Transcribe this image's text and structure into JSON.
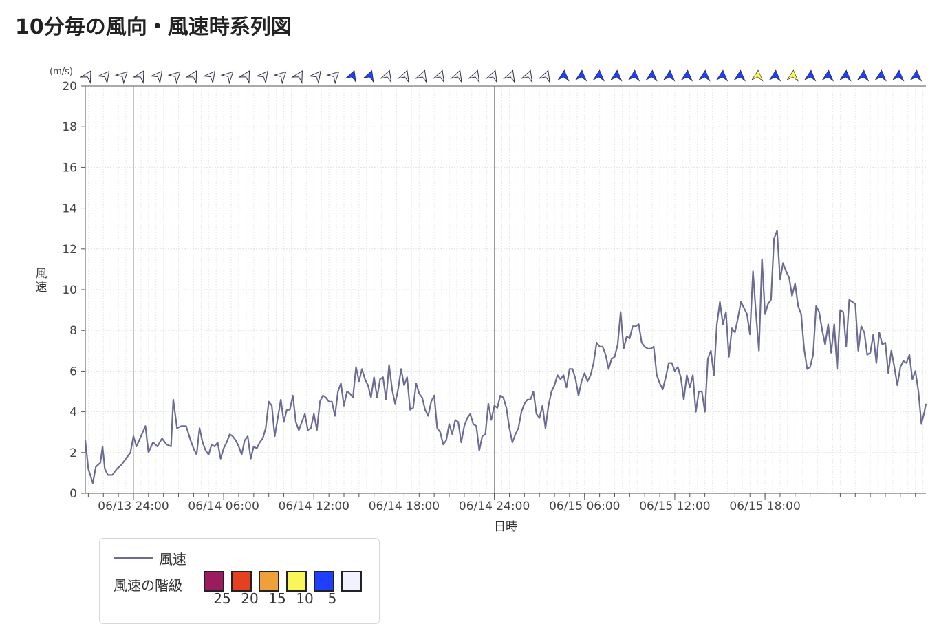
{
  "title": "10分毎の風向・風速時系列図",
  "legend": {
    "series_label": "風速",
    "classes_label": "風速の階級",
    "classes": [
      {
        "color": "#9b1c5e",
        "label": "25"
      },
      {
        "color": "#e5401f",
        "label": "20"
      },
      {
        "color": "#f0a03a",
        "label": "15"
      },
      {
        "color": "#f9f65a",
        "label": "10"
      },
      {
        "color": "#1e3ffb",
        "label": "5"
      },
      {
        "color": "#f1f2fd",
        "label": ""
      }
    ]
  },
  "chart_data": {
    "type": "line",
    "ylabel": "風速",
    "xlabel": "日時",
    "yunit": "(m/s)",
    "ylim": [
      0,
      20
    ],
    "yticks": [
      0,
      2,
      4,
      6,
      8,
      10,
      12,
      14,
      16,
      18,
      20
    ],
    "xlim_hours": [
      20.8,
      68.7
    ],
    "xticks": [
      {
        "hour": 24,
        "label": "06/13 24:00"
      },
      {
        "hour": 30,
        "label": "06/14 06:00"
      },
      {
        "hour": 36,
        "label": "06/14 12:00"
      },
      {
        "hour": 42,
        "label": "06/14 18:00"
      },
      {
        "hour": 48,
        "label": "06/14 24:00"
      },
      {
        "hour": 54,
        "label": "06/15 06:00"
      },
      {
        "hour": 60,
        "label": "06/15 12:00"
      },
      {
        "hour": 66,
        "label": "06/15 18:00"
      }
    ],
    "grid": true,
    "series": [
      {
        "name": "風速",
        "color": "#6b6b96",
        "points": [
          [
            20.8,
            2.6
          ],
          [
            21.0,
            1.2
          ],
          [
            21.3,
            0.5
          ],
          [
            21.5,
            1.3
          ],
          [
            21.8,
            1.5
          ],
          [
            21.95,
            2.3
          ],
          [
            22.1,
            1.2
          ],
          [
            22.3,
            0.9
          ],
          [
            22.6,
            0.9
          ],
          [
            22.9,
            1.2
          ],
          [
            23.2,
            1.4
          ],
          [
            23.5,
            1.7
          ],
          [
            23.8,
            2.0
          ],
          [
            24.0,
            2.8
          ],
          [
            24.2,
            2.3
          ],
          [
            24.5,
            2.8
          ],
          [
            24.8,
            3.3
          ],
          [
            25.0,
            2.0
          ],
          [
            25.3,
            2.5
          ],
          [
            25.6,
            2.3
          ],
          [
            25.9,
            2.7
          ],
          [
            26.2,
            2.4
          ],
          [
            26.5,
            2.3
          ],
          [
            26.65,
            4.6
          ],
          [
            26.9,
            3.2
          ],
          [
            27.2,
            3.3
          ],
          [
            27.5,
            3.3
          ],
          [
            27.8,
            2.6
          ],
          [
            28.0,
            2.2
          ],
          [
            28.2,
            1.9
          ],
          [
            28.4,
            3.2
          ],
          [
            28.6,
            2.5
          ],
          [
            28.8,
            2.1
          ],
          [
            29.0,
            1.9
          ],
          [
            29.2,
            2.4
          ],
          [
            29.4,
            2.3
          ],
          [
            29.6,
            2.5
          ],
          [
            29.8,
            1.7
          ],
          [
            30.0,
            2.2
          ],
          [
            30.2,
            2.5
          ],
          [
            30.4,
            2.9
          ],
          [
            30.6,
            2.8
          ],
          [
            30.8,
            2.6
          ],
          [
            31.0,
            2.3
          ],
          [
            31.2,
            1.9
          ],
          [
            31.4,
            2.6
          ],
          [
            31.6,
            2.8
          ],
          [
            31.8,
            1.7
          ],
          [
            32.0,
            2.3
          ],
          [
            32.2,
            2.2
          ],
          [
            32.4,
            2.5
          ],
          [
            32.6,
            2.7
          ],
          [
            32.8,
            3.2
          ],
          [
            33.0,
            4.5
          ],
          [
            33.2,
            4.3
          ],
          [
            33.4,
            2.8
          ],
          [
            33.6,
            3.7
          ],
          [
            33.8,
            4.6
          ],
          [
            34.0,
            3.5
          ],
          [
            34.2,
            4.1
          ],
          [
            34.4,
            4.1
          ],
          [
            34.6,
            4.8
          ],
          [
            34.8,
            3.5
          ],
          [
            35.0,
            3.1
          ],
          [
            35.2,
            3.5
          ],
          [
            35.4,
            3.9
          ],
          [
            35.6,
            3.1
          ],
          [
            35.8,
            3.2
          ],
          [
            36.0,
            3.9
          ],
          [
            36.2,
            3.1
          ],
          [
            36.4,
            4.5
          ],
          [
            36.6,
            4.8
          ],
          [
            36.8,
            4.7
          ],
          [
            37.0,
            4.5
          ],
          [
            37.2,
            4.5
          ],
          [
            37.4,
            3.8
          ],
          [
            37.6,
            5.0
          ],
          [
            37.8,
            5.4
          ],
          [
            38.0,
            4.3
          ],
          [
            38.2,
            5.0
          ],
          [
            38.4,
            4.9
          ],
          [
            38.6,
            4.7
          ],
          [
            38.8,
            6.2
          ],
          [
            39.0,
            5.5
          ],
          [
            39.2,
            6.1
          ],
          [
            39.4,
            5.6
          ],
          [
            39.6,
            5.3
          ],
          [
            39.8,
            4.7
          ],
          [
            40.0,
            5.7
          ],
          [
            40.2,
            4.7
          ],
          [
            40.4,
            5.6
          ],
          [
            40.6,
            5.7
          ],
          [
            40.8,
            4.6
          ],
          [
            41.0,
            6.3
          ],
          [
            41.2,
            5.1
          ],
          [
            41.4,
            4.4
          ],
          [
            41.6,
            5.1
          ],
          [
            41.8,
            6.1
          ],
          [
            42.0,
            5.3
          ],
          [
            42.2,
            5.7
          ],
          [
            42.4,
            4.1
          ],
          [
            42.6,
            4.2
          ],
          [
            42.8,
            5.4
          ],
          [
            43.0,
            4.9
          ],
          [
            43.2,
            4.7
          ],
          [
            43.4,
            4.1
          ],
          [
            43.6,
            3.8
          ],
          [
            43.8,
            4.5
          ],
          [
            44.0,
            4.8
          ],
          [
            44.2,
            3.2
          ],
          [
            44.4,
            3.0
          ],
          [
            44.6,
            2.4
          ],
          [
            44.8,
            2.6
          ],
          [
            45.0,
            3.4
          ],
          [
            45.2,
            2.9
          ],
          [
            45.4,
            3.6
          ],
          [
            45.6,
            3.5
          ],
          [
            45.8,
            2.5
          ],
          [
            46.0,
            3.3
          ],
          [
            46.2,
            3.7
          ],
          [
            46.4,
            3.9
          ],
          [
            46.6,
            3.4
          ],
          [
            46.8,
            3.3
          ],
          [
            47.0,
            2.1
          ],
          [
            47.2,
            2.8
          ],
          [
            47.4,
            2.9
          ],
          [
            47.6,
            4.4
          ],
          [
            47.8,
            3.6
          ],
          [
            48.0,
            4.3
          ],
          [
            48.2,
            4.2
          ],
          [
            48.4,
            4.8
          ],
          [
            48.6,
            4.7
          ],
          [
            48.8,
            4.2
          ],
          [
            49.0,
            3.2
          ],
          [
            49.2,
            2.5
          ],
          [
            49.4,
            2.9
          ],
          [
            49.6,
            3.2
          ],
          [
            49.8,
            4.0
          ],
          [
            50.0,
            4.4
          ],
          [
            50.2,
            4.6
          ],
          [
            50.4,
            4.6
          ],
          [
            50.6,
            5.0
          ],
          [
            50.8,
            3.9
          ],
          [
            51.0,
            3.7
          ],
          [
            51.2,
            4.3
          ],
          [
            51.4,
            3.2
          ],
          [
            51.6,
            4.3
          ],
          [
            51.8,
            5.0
          ],
          [
            52.0,
            5.3
          ],
          [
            52.2,
            5.8
          ],
          [
            52.4,
            5.6
          ],
          [
            52.6,
            5.8
          ],
          [
            52.8,
            5.2
          ],
          [
            53.0,
            6.1
          ],
          [
            53.2,
            6.1
          ],
          [
            53.4,
            5.6
          ],
          [
            53.6,
            4.8
          ],
          [
            53.8,
            5.5
          ],
          [
            54.0,
            5.9
          ],
          [
            54.2,
            5.5
          ],
          [
            54.4,
            5.8
          ],
          [
            54.6,
            6.4
          ],
          [
            54.8,
            7.4
          ],
          [
            55.0,
            7.2
          ],
          [
            55.2,
            7.2
          ],
          [
            55.4,
            6.8
          ],
          [
            55.6,
            6.1
          ],
          [
            55.8,
            6.6
          ],
          [
            56.0,
            6.7
          ],
          [
            56.2,
            7.3
          ],
          [
            56.4,
            8.9
          ],
          [
            56.6,
            7.1
          ],
          [
            56.8,
            7.7
          ],
          [
            57.0,
            7.6
          ],
          [
            57.2,
            8.2
          ],
          [
            57.4,
            8.2
          ],
          [
            57.6,
            8.3
          ],
          [
            57.8,
            7.4
          ],
          [
            58.0,
            7.2
          ],
          [
            58.2,
            7.1
          ],
          [
            58.4,
            7.1
          ],
          [
            58.6,
            7.2
          ],
          [
            58.8,
            5.8
          ],
          [
            59.0,
            5.4
          ],
          [
            59.2,
            5.1
          ],
          [
            59.4,
            5.7
          ],
          [
            59.6,
            6.4
          ],
          [
            59.8,
            6.4
          ],
          [
            60.0,
            6.0
          ],
          [
            60.2,
            6.2
          ],
          [
            60.4,
            5.7
          ],
          [
            60.6,
            4.6
          ],
          [
            60.8,
            5.8
          ],
          [
            61.0,
            5.2
          ],
          [
            61.2,
            5.8
          ],
          [
            61.4,
            4.0
          ],
          [
            61.6,
            5.0
          ],
          [
            61.8,
            5.0
          ],
          [
            62.0,
            4.0
          ],
          [
            62.2,
            6.6
          ],
          [
            62.4,
            7.0
          ],
          [
            62.6,
            5.8
          ],
          [
            62.8,
            8.3
          ],
          [
            63.0,
            9.4
          ],
          [
            63.2,
            8.3
          ],
          [
            63.4,
            8.9
          ],
          [
            63.6,
            6.7
          ],
          [
            63.8,
            8.1
          ],
          [
            64.0,
            7.9
          ],
          [
            64.2,
            8.6
          ],
          [
            64.4,
            9.4
          ],
          [
            64.6,
            9.1
          ],
          [
            64.8,
            8.8
          ],
          [
            65.0,
            7.8
          ],
          [
            65.2,
            10.9
          ],
          [
            65.4,
            8.8
          ],
          [
            65.6,
            7.0
          ],
          [
            65.8,
            11.5
          ],
          [
            66.0,
            8.8
          ],
          [
            66.2,
            9.3
          ],
          [
            66.4,
            9.5
          ],
          [
            66.6,
            12.5
          ],
          [
            66.8,
            12.9
          ],
          [
            67.0,
            10.5
          ],
          [
            67.2,
            11.3
          ],
          [
            67.4,
            10.9
          ],
          [
            67.6,
            10.6
          ],
          [
            67.8,
            9.7
          ],
          [
            68.0,
            10.3
          ],
          [
            68.2,
            9.2
          ],
          [
            68.4,
            8.8
          ],
          [
            68.6,
            7.1
          ],
          [
            68.8,
            6.1
          ],
          [
            69.0,
            6.2
          ],
          [
            69.2,
            6.8
          ],
          [
            69.4,
            9.2
          ],
          [
            69.6,
            8.9
          ],
          [
            69.8,
            8.0
          ],
          [
            70.0,
            7.3
          ],
          [
            70.2,
            8.3
          ],
          [
            70.4,
            6.9
          ],
          [
            70.6,
            8.3
          ],
          [
            70.8,
            6.1
          ],
          [
            71.0,
            9.0
          ],
          [
            71.2,
            8.9
          ],
          [
            71.4,
            7.2
          ],
          [
            71.6,
            9.5
          ],
          [
            71.8,
            9.4
          ],
          [
            72.0,
            9.3
          ],
          [
            72.2,
            7.0
          ],
          [
            72.4,
            8.2
          ],
          [
            72.6,
            7.9
          ],
          [
            72.8,
            6.8
          ],
          [
            73.0,
            6.9
          ],
          [
            73.2,
            7.8
          ],
          [
            73.4,
            6.4
          ],
          [
            73.6,
            7.9
          ],
          [
            73.8,
            7.3
          ],
          [
            74.0,
            7.4
          ],
          [
            74.2,
            5.9
          ],
          [
            74.4,
            7.0
          ],
          [
            74.6,
            6.2
          ],
          [
            74.8,
            5.3
          ],
          [
            75.0,
            6.2
          ],
          [
            75.2,
            6.5
          ],
          [
            75.4,
            6.4
          ],
          [
            75.6,
            6.8
          ],
          [
            75.8,
            5.6
          ],
          [
            76.0,
            6.0
          ],
          [
            76.2,
            5.0
          ],
          [
            76.4,
            3.4
          ],
          [
            76.6,
            4.0
          ],
          [
            76.7,
            4.4
          ]
        ]
      }
    ],
    "wind_direction_arrows": {
      "count": 48,
      "colors": [
        "#f1f2fd",
        "#f1f2fd",
        "#f1f2fd",
        "#f1f2fd",
        "#f1f2fd",
        "#f1f2fd",
        "#f1f2fd",
        "#f1f2fd",
        "#f1f2fd",
        "#f1f2fd",
        "#f1f2fd",
        "#f1f2fd",
        "#f1f2fd",
        "#f1f2fd",
        "#f1f2fd",
        "#1e3ffb",
        "#1e3ffb",
        "#f1f2fd",
        "#f1f2fd",
        "#f1f2fd",
        "#f1f2fd",
        "#f1f2fd",
        "#f1f2fd",
        "#f1f2fd",
        "#f1f2fd",
        "#f1f2fd",
        "#f1f2fd",
        "#1e3ffb",
        "#1e3ffb",
        "#1e3ffb",
        "#1e3ffb",
        "#1e3ffb",
        "#1e3ffb",
        "#1e3ffb",
        "#1e3ffb",
        "#1e3ffb",
        "#1e3ffb",
        "#1e3ffb",
        "#f9f65a",
        "#1e3ffb",
        "#f9f65a",
        "#1e3ffb",
        "#1e3ffb",
        "#1e3ffb",
        "#1e3ffb",
        "#1e3ffb",
        "#1e3ffb",
        "#1e3ffb"
      ]
    }
  }
}
